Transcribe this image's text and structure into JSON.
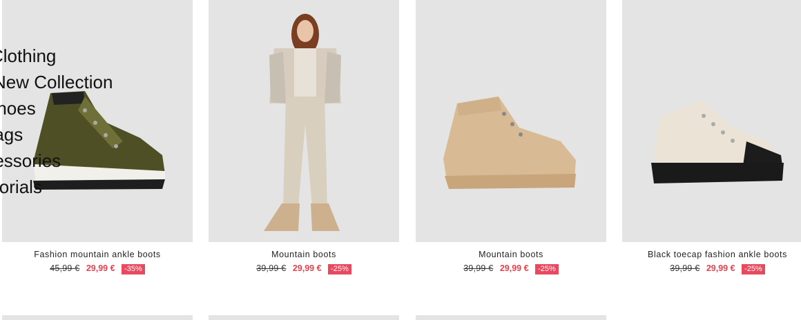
{
  "menu": {
    "items": [
      "Clothing",
      "New Collection",
      "Shoes",
      "Bags",
      "Accessories",
      "Editorials"
    ]
  },
  "products": [
    {
      "name": "Fashion mountain ankle boots",
      "old_price": "45,99 €",
      "new_price": "29,99 €",
      "discount": "-35%"
    },
    {
      "name": "Mountain boots",
      "old_price": "39,99 €",
      "new_price": "29,99 €",
      "discount": "-25%"
    },
    {
      "name": "Mountain boots",
      "old_price": "39,99 €",
      "new_price": "29,99 €",
      "discount": "-25%"
    },
    {
      "name": "Black toecap fashion ankle boots",
      "old_price": "39,99 €",
      "new_price": "29,99 €",
      "discount": "-25%"
    }
  ],
  "colors": {
    "sale": "#e5414f",
    "badge": "#e8495f",
    "image_bg": "#e4e4e4"
  }
}
